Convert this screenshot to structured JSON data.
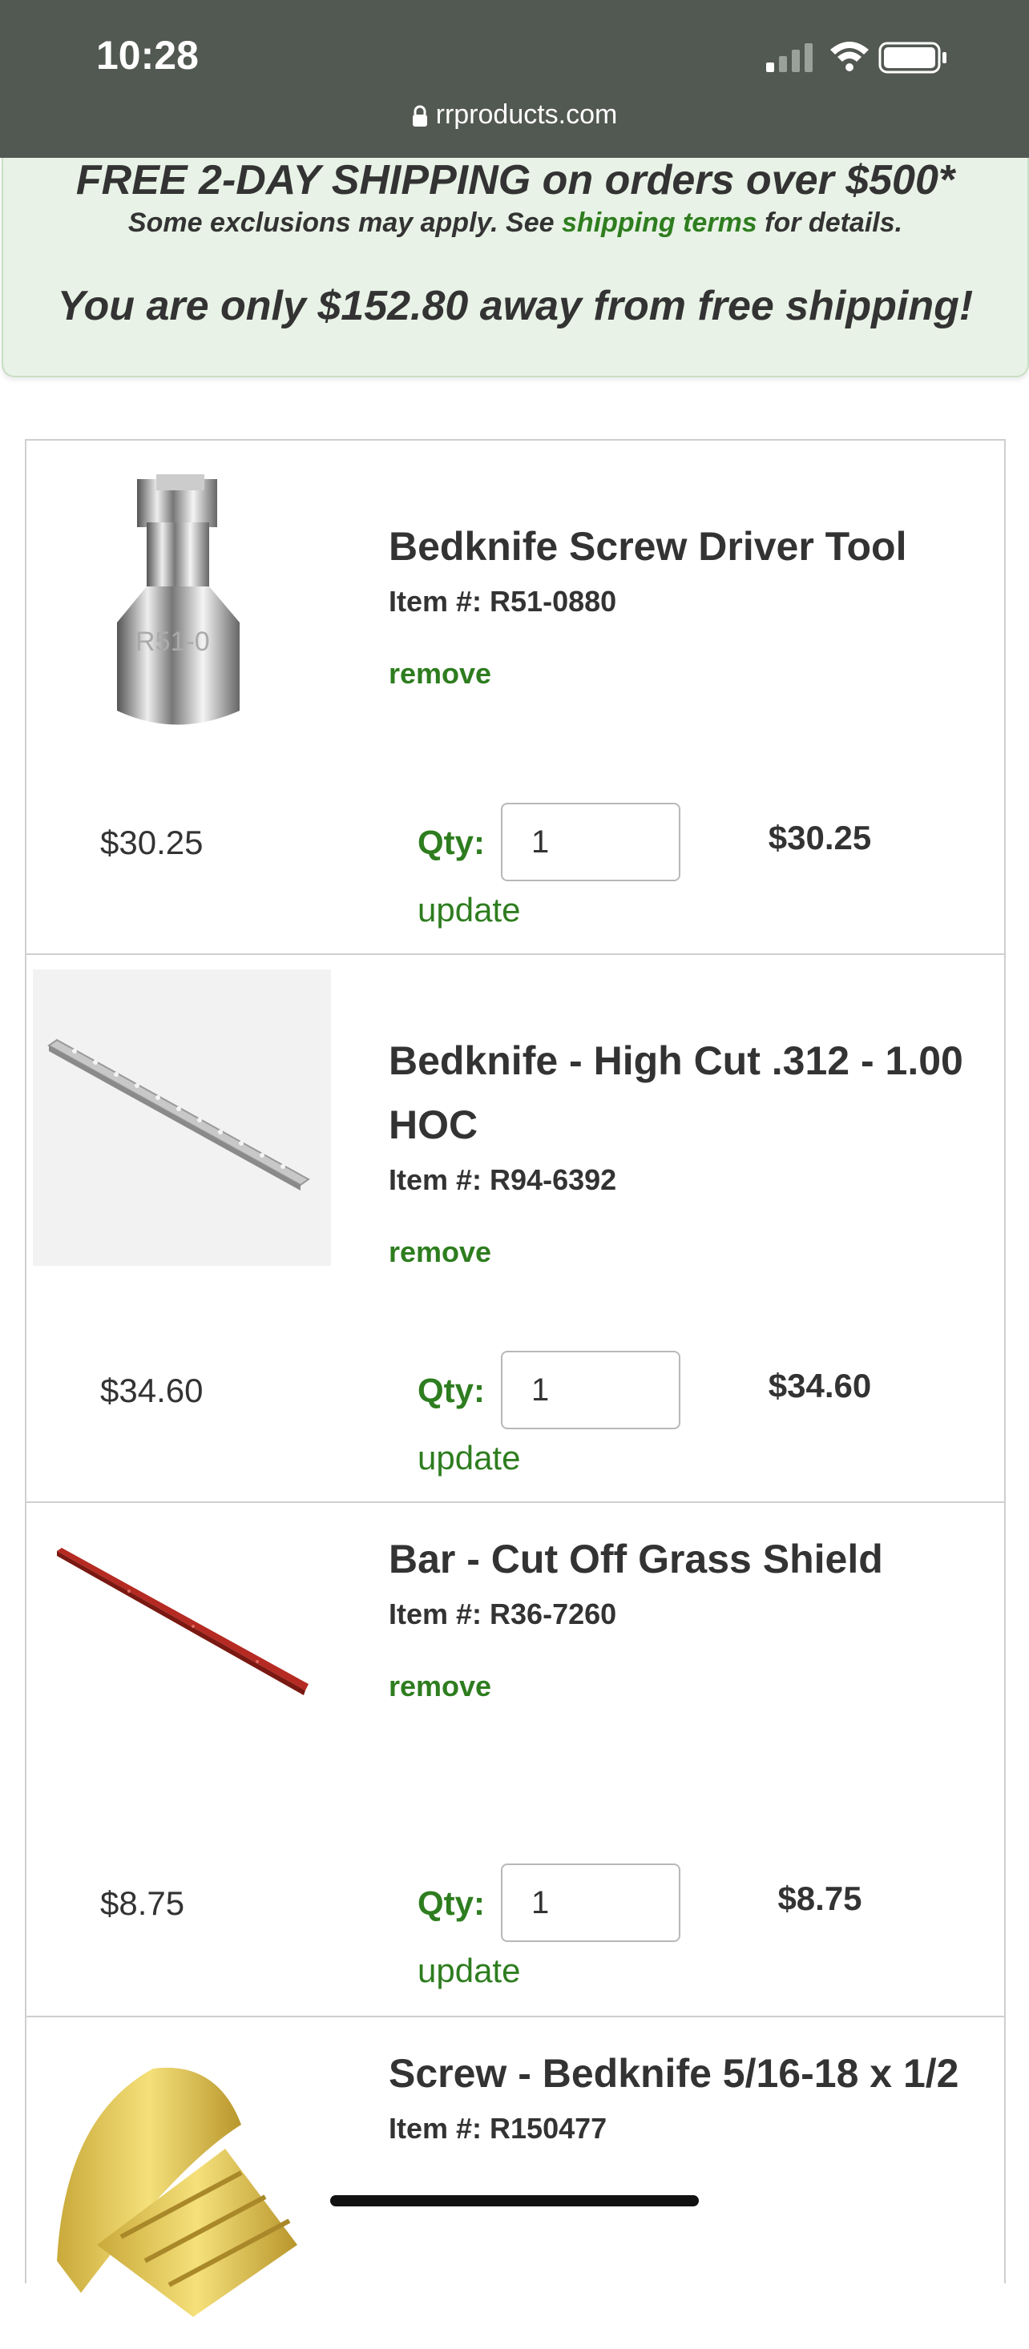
{
  "status_bar": {
    "time": "10:28",
    "url": "rrproducts.com",
    "icons": [
      "cellular-signal-icon",
      "wifi-icon",
      "battery-icon"
    ]
  },
  "shipping_banner": {
    "headline": "FREE 2-DAY SHIPPING on orders over $500*",
    "exclusions_prefix": "Some exclusions may apply. See ",
    "terms_link": "shipping terms",
    "exclusions_suffix": " for details.",
    "progress_message": "You are only $152.80 away from free shipping!"
  },
  "cart": {
    "items": [
      {
        "name": "Bedknife Screw Driver Tool",
        "sku": "Item #: R51-0880",
        "remove_label": "remove",
        "price": "$30.25",
        "qty_label": "Qty:",
        "qty": "1",
        "update_label": "update",
        "total": "$30.25",
        "image": "bedknife-screwdriver-socket-image"
      },
      {
        "name": "Bedknife - High Cut .312 - 1.00 HOC",
        "sku": "Item #: R94-6392",
        "remove_label": "remove",
        "price": "$34.60",
        "qty_label": "Qty:",
        "qty": "1",
        "update_label": "update",
        "total": "$34.60",
        "image": "bedknife-bar-image"
      },
      {
        "name": "Bar - Cut Off Grass Shield",
        "sku": "Item #: R36-7260",
        "remove_label": "remove",
        "price": "$8.75",
        "qty_label": "Qty:",
        "qty": "1",
        "update_label": "update",
        "total": "$8.75",
        "image": "grass-shield-bar-image"
      },
      {
        "name": "Screw - Bedknife 5/16-18 x 1/2",
        "sku": "Item #: R150477",
        "image": "brass-screw-image"
      }
    ]
  },
  "colors": {
    "brand_green": "#2e7d1f",
    "banner_bg": "#e8f2e6",
    "status_bar_bg": "#525852"
  }
}
